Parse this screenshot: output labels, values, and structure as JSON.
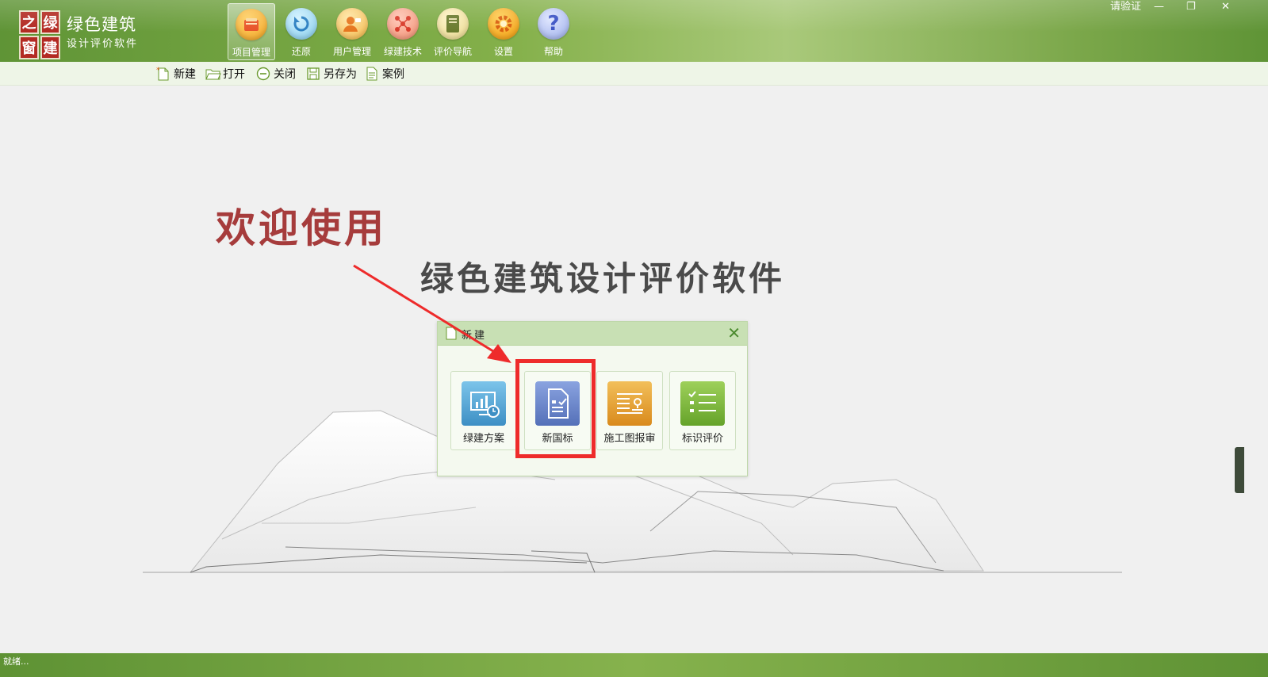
{
  "app": {
    "logo_chars": [
      "之",
      "绿",
      "窗",
      "建"
    ],
    "name": "绿色建筑",
    "subtitle": "设计评价软件"
  },
  "toolbar": {
    "items": [
      {
        "label": "项目管理",
        "icon": "project-icon",
        "active": true
      },
      {
        "label": "还原",
        "icon": "restore-icon"
      },
      {
        "label": "用户管理",
        "icon": "user-icon"
      },
      {
        "label": "绿建技术",
        "icon": "tech-icon"
      },
      {
        "label": "评价导航",
        "icon": "guide-book-icon"
      },
      {
        "label": "设置",
        "icon": "gear-icon"
      },
      {
        "label": "帮助",
        "icon": "help-icon"
      }
    ]
  },
  "window": {
    "verify_label": "请验证",
    "minimize": "—",
    "restore": "❐",
    "close": "✕"
  },
  "subbar": {
    "new": "新建",
    "open": "打开",
    "close": "关闭",
    "save_as": "另存为",
    "cases": "案例"
  },
  "welcome": {
    "heading": "欢迎使用",
    "title": "绿色建筑设计评价软件"
  },
  "dialog": {
    "title": "新建",
    "close": "✕",
    "options": [
      {
        "label": "绿建方案",
        "color": "#4a9fd1"
      },
      {
        "label": "新国标",
        "color": "#5f7cc3"
      },
      {
        "label": "施工图报审",
        "color": "#e8a12f"
      },
      {
        "label": "标识评价",
        "color": "#7ab53c"
      }
    ]
  },
  "status": {
    "text": "就绪..."
  }
}
